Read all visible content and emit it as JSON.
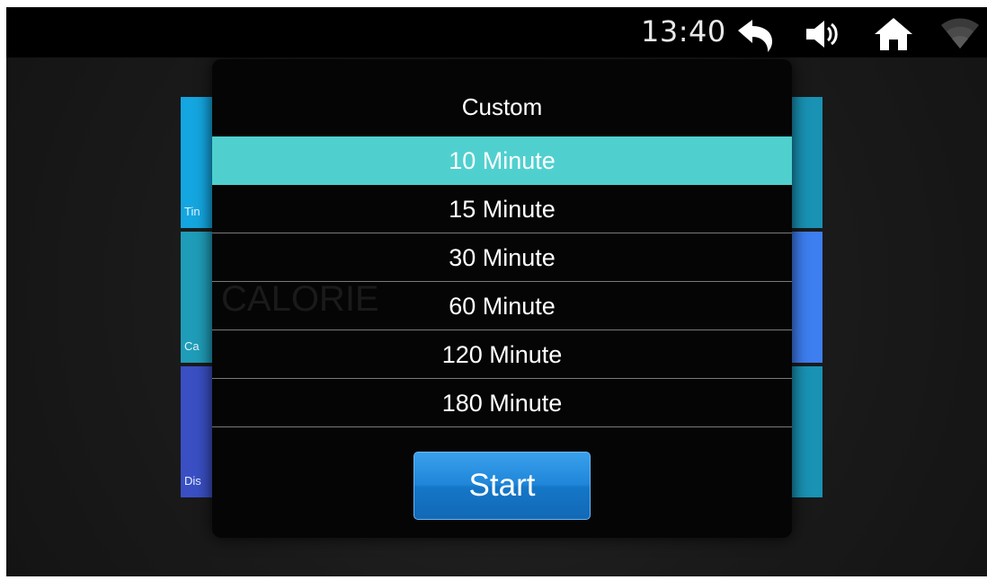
{
  "status_bar": {
    "time": "13:40",
    "icons": [
      "back-icon",
      "volume-icon",
      "home-icon",
      "wifi-icon"
    ]
  },
  "background_tiles": {
    "left_labels": [
      "Tin",
      "Ca",
      "Dis"
    ],
    "calorie_text": "CALORIE",
    "colors": {
      "tile_blue_1": "#14a6e0",
      "tile_teal": "#1f9db8",
      "tile_indigo": "#3a4fc4",
      "tile_right_teal": "#1992b4",
      "tile_right_blue": "#3d7ef0"
    }
  },
  "dialog": {
    "title": "Custom",
    "options": [
      "10 Minute",
      "15 Minute",
      "30 Minute",
      "60 Minute",
      "120 Minute",
      "180 Minute"
    ],
    "selected": "10 Minute",
    "start_label": "Start",
    "colors": {
      "selection": "#4fd0cf",
      "start_button": "#1f86d9"
    }
  }
}
